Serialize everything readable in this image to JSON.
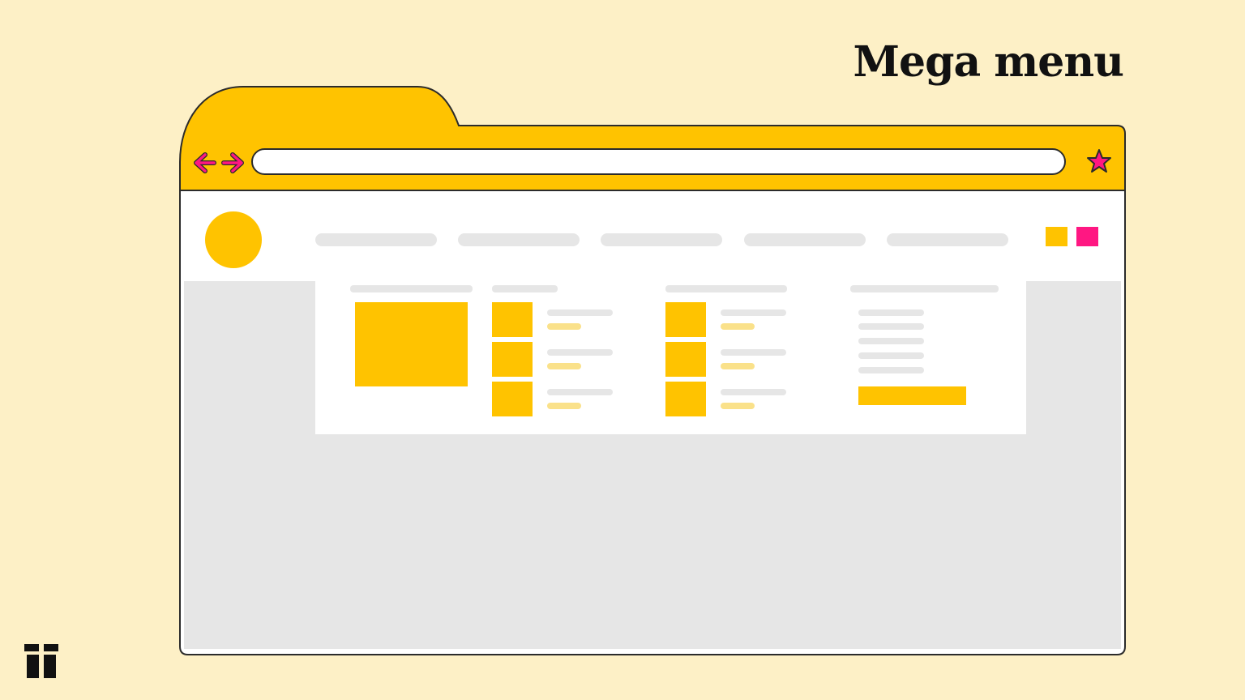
{
  "title": "Mega menu",
  "colors": {
    "background": "#fdf0c6",
    "accent_yellow": "#ffc300",
    "accent_pink": "#ff1782",
    "placeholder_gray": "#e6e6e6",
    "placeholder_light_yellow": "#fae18a",
    "outline": "#2b2b2b"
  },
  "browser": {
    "back_icon": "arrow-left-icon",
    "forward_icon": "arrow-right-icon",
    "bookmark_icon": "star-icon",
    "address_value": ""
  },
  "site_header": {
    "logo": "circle-logo",
    "nav_item_count": 5,
    "header_squares": [
      "yellow",
      "pink"
    ]
  },
  "mega_menu": {
    "columns": [
      {
        "type": "feature-image"
      },
      {
        "type": "thumbnail-list",
        "items": 3
      },
      {
        "type": "thumbnail-list",
        "items": 3
      },
      {
        "type": "link-list",
        "items": 5,
        "cta": "yellow-button"
      }
    ]
  },
  "brand_mark": "logo-mark-icon"
}
